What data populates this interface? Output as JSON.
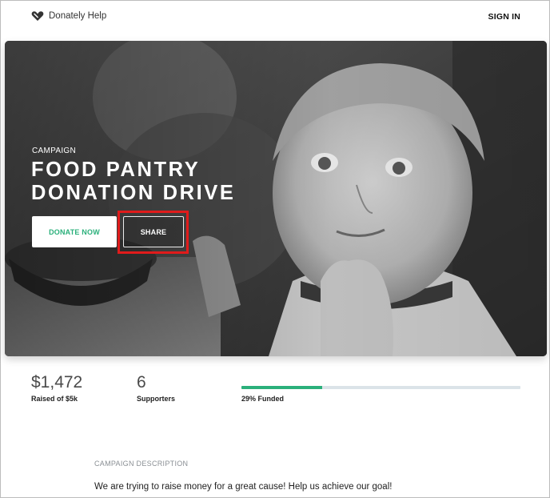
{
  "header": {
    "brand_name": "Donately Help",
    "brand_icon": "heart-tag-icon",
    "signin_label": "SIGN IN"
  },
  "hero": {
    "kicker": "CAMPAIGN",
    "title": "FOOD PANTRY DONATION DRIVE",
    "donate_label": "DONATE NOW",
    "share_label": "SHARE",
    "highlight_color": "#e01b1b",
    "image_description": "black-and-white photo of a smiling toddler eating"
  },
  "stats": {
    "amount": "$1,472",
    "amount_label": "Raised of $5k",
    "supporters": "6",
    "supporters_label": "Supporters",
    "funded_fraction": 0.29,
    "funded_label": "29% Funded"
  },
  "description": {
    "heading": "CAMPAIGN DESCRIPTION",
    "text": "We are trying to raise money for a great cause! Help us achieve our goal!"
  },
  "colors": {
    "accent": "#2bb07b",
    "track": "#dbe3e8",
    "muted_text": "#8a8f94"
  }
}
